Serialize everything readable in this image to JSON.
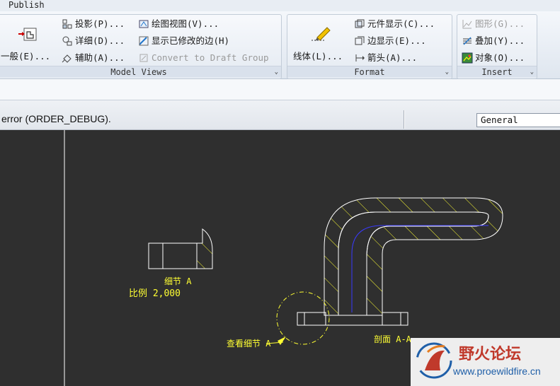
{
  "menu": {
    "publish": "Publish"
  },
  "ribbon": {
    "general_button": "一般(E)...",
    "model_views": {
      "label": "Model Views",
      "projection": "投影(P)...",
      "detailed": "详细(D)...",
      "auxiliary": "辅助(A)...",
      "drawing_view": "绘图视图(V)...",
      "show_modified_edges": "显示已修改的边(H)",
      "convert_to_draft_group": "Convert to Draft Group"
    },
    "format": {
      "label": "Format",
      "line_style": "线体(L)...",
      "component_display": "元件显示(C)...",
      "edge_display": "边显示(E)...",
      "arrow": "箭头(A)..."
    },
    "insert": {
      "label": "Insert",
      "graph": "图形(G)...",
      "overlay": "叠加(Y)...",
      "object": "对象(O)..."
    }
  },
  "status": {
    "message": "error (ORDER_DEBUG).",
    "filter_value": "General"
  },
  "drawing": {
    "detail_label": "细节 A",
    "scale_label": "比例 2,000",
    "see_detail_label": "查看细节 A",
    "section_label": "剖面 A-A"
  },
  "watermark": {
    "name": "野火论坛",
    "url": "www.proewildfire.cn"
  },
  "colors": {
    "canvas": "#2f2f2f",
    "geometry": "#ffffff",
    "hatch": "#ffff33",
    "annotation": "#ffff33",
    "centerline": "#3a3aff",
    "watermark_red": "#c0392b"
  }
}
